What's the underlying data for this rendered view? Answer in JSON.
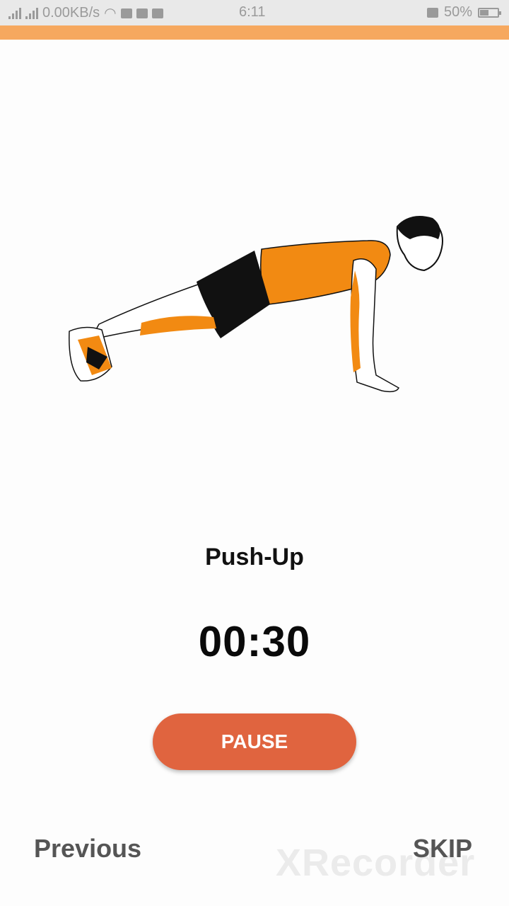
{
  "status_bar": {
    "network_speed": "0.00KB/s",
    "time": "6:11",
    "battery_percent": "50%",
    "battery_level": 0.5
  },
  "colors": {
    "accent": "#f6a85f",
    "pause_button": "#e0643f",
    "shirt": "#f28a12"
  },
  "illustration": {
    "icon": "push-up-illustration"
  },
  "exercise": {
    "name": "Push-Up",
    "timer": "00:30"
  },
  "controls": {
    "pause_label": "PAUSE",
    "previous_label": "Previous",
    "skip_label": "SKIP"
  },
  "watermark": "XRecorder"
}
